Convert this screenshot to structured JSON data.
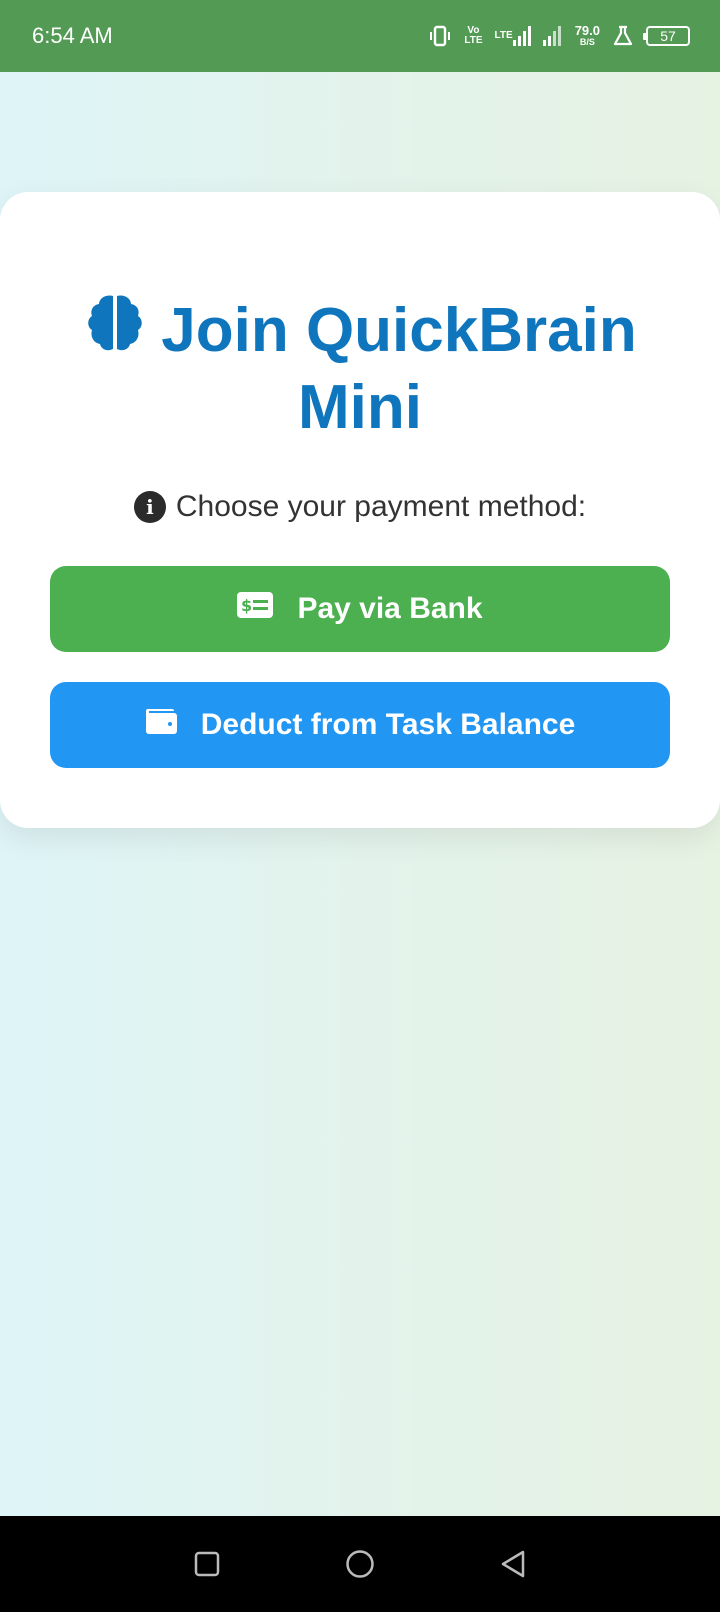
{
  "status_bar": {
    "time": "6:54 AM",
    "volte": "Vo\nLTE",
    "lte": "LTE",
    "speed": "79.0",
    "speed_unit": "B/S",
    "battery": "57"
  },
  "card": {
    "title_line1": "Join QuickBrain",
    "title_line2": "Mini",
    "title_icon": "brain-icon",
    "subtitle": "Choose your payment method:",
    "subtitle_icon": "info-icon",
    "buttons": [
      {
        "label": "Pay via Bank",
        "icon": "money-check-icon",
        "color": "#4caf50"
      },
      {
        "label": "Deduct from Task Balance",
        "icon": "wallet-icon",
        "color": "#2196f3"
      }
    ]
  },
  "colors": {
    "status_bar": "#539a55",
    "title": "#0f76bd"
  }
}
